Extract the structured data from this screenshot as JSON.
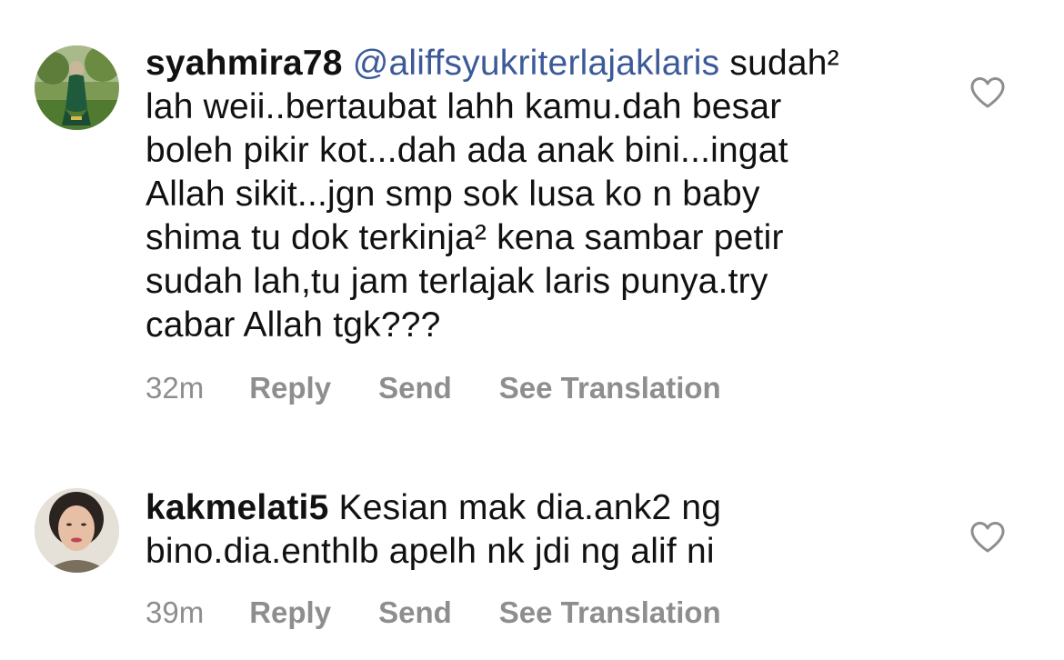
{
  "comments": [
    {
      "username": "syahmira78",
      "mention": "@aliffsyukriterlajaklaris",
      "lines": [
        " sudah²",
        "lah weii..bertaubat lahh kamu.dah besar",
        "boleh pikir kot...dah ada anak bini...ingat",
        "Allah sikit...jgn smp sok lusa ko n baby",
        "shima tu dok terkinja² kena sambar petir",
        "sudah lah,tu jam  terlajak laris punya.try",
        "cabar Allah tgk???"
      ],
      "time": "32m",
      "reply_label": "Reply",
      "send_label": "Send",
      "translate_label": "See Translation",
      "like_icon": "heart-outline-icon"
    },
    {
      "username": "kakmelati5",
      "mention": "",
      "lines": [
        " Kesian mak dia.ank2 ng",
        "bino.dia.enthlb apelh nk jdi ng alif ni"
      ],
      "time": "39m",
      "reply_label": "Reply",
      "send_label": "Send",
      "translate_label": "See Translation",
      "like_icon": "heart-outline-icon"
    }
  ],
  "colors": {
    "text": "#111111",
    "mention": "#3c5a99",
    "meta": "#8e8e8e"
  }
}
